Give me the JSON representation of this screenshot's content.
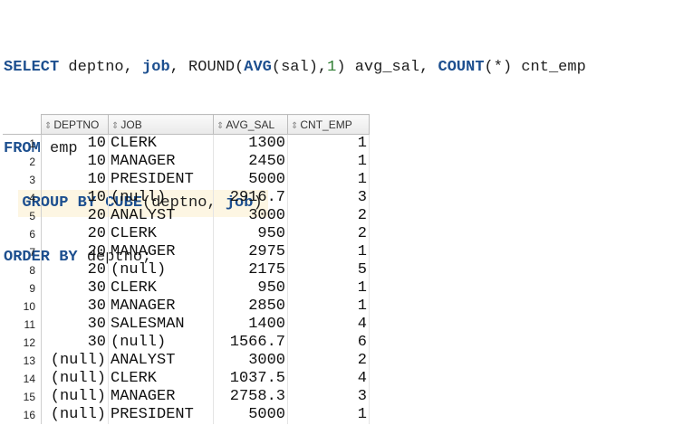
{
  "sql": {
    "line1": [
      {
        "t": "SELECT",
        "k": "kw"
      },
      {
        "t": " deptno, ",
        "k": ""
      },
      {
        "t": "job",
        "k": "kw"
      },
      {
        "t": ", ROUND(",
        "k": ""
      },
      {
        "t": "AVG",
        "k": "kw"
      },
      {
        "t": "(sal),",
        "k": ""
      },
      {
        "t": "1",
        "k": "num"
      },
      {
        "t": ") avg_sal, ",
        "k": ""
      },
      {
        "t": "COUNT",
        "k": "kw"
      },
      {
        "t": "(*) cnt_emp",
        "k": ""
      }
    ],
    "line2": [
      {
        "t": "FROM",
        "k": "kw"
      },
      {
        "t": " emp",
        "k": ""
      }
    ],
    "line3": [
      {
        "t": "GROUP BY CUBE",
        "k": "kw"
      },
      {
        "t": "(deptno, ",
        "k": ""
      },
      {
        "t": "job",
        "k": "kw"
      },
      {
        "t": ")",
        "k": ""
      }
    ],
    "line4": [
      {
        "t": "ORDER BY",
        "k": "kw"
      },
      {
        "t": " deptno;",
        "k": ""
      }
    ]
  },
  "grid": {
    "columns": [
      "DEPTNO",
      "JOB",
      "AVG_SAL",
      "CNT_EMP"
    ],
    "sort_icon": "⇕",
    "rows": [
      [
        "1",
        "10",
        "CLERK",
        "1300",
        "1"
      ],
      [
        "2",
        "10",
        "MANAGER",
        "2450",
        "1"
      ],
      [
        "3",
        "10",
        "PRESIDENT",
        "5000",
        "1"
      ],
      [
        "4",
        "10",
        "(null)",
        "2916.7",
        "3"
      ],
      [
        "5",
        "20",
        "ANALYST",
        "3000",
        "2"
      ],
      [
        "6",
        "20",
        "CLERK",
        "950",
        "2"
      ],
      [
        "7",
        "20",
        "MANAGER",
        "2975",
        "1"
      ],
      [
        "8",
        "20",
        "(null)",
        "2175",
        "5"
      ],
      [
        "9",
        "30",
        "CLERK",
        "950",
        "1"
      ],
      [
        "10",
        "30",
        "MANAGER",
        "2850",
        "1"
      ],
      [
        "11",
        "30",
        "SALESMAN",
        "1400",
        "4"
      ],
      [
        "12",
        "30",
        "(null)",
        "1566.7",
        "6"
      ],
      [
        "13",
        "(null)",
        "ANALYST",
        "3000",
        "2"
      ],
      [
        "14",
        "(null)",
        "CLERK",
        "1037.5",
        "4"
      ],
      [
        "15",
        "(null)",
        "MANAGER",
        "2758.3",
        "3"
      ],
      [
        "16",
        "(null)",
        "PRESIDENT",
        "5000",
        "1"
      ]
    ]
  },
  "colors": {
    "keyword": "#1d4f8f",
    "number": "#2e7d32",
    "highlight": "#fdf6e3"
  }
}
